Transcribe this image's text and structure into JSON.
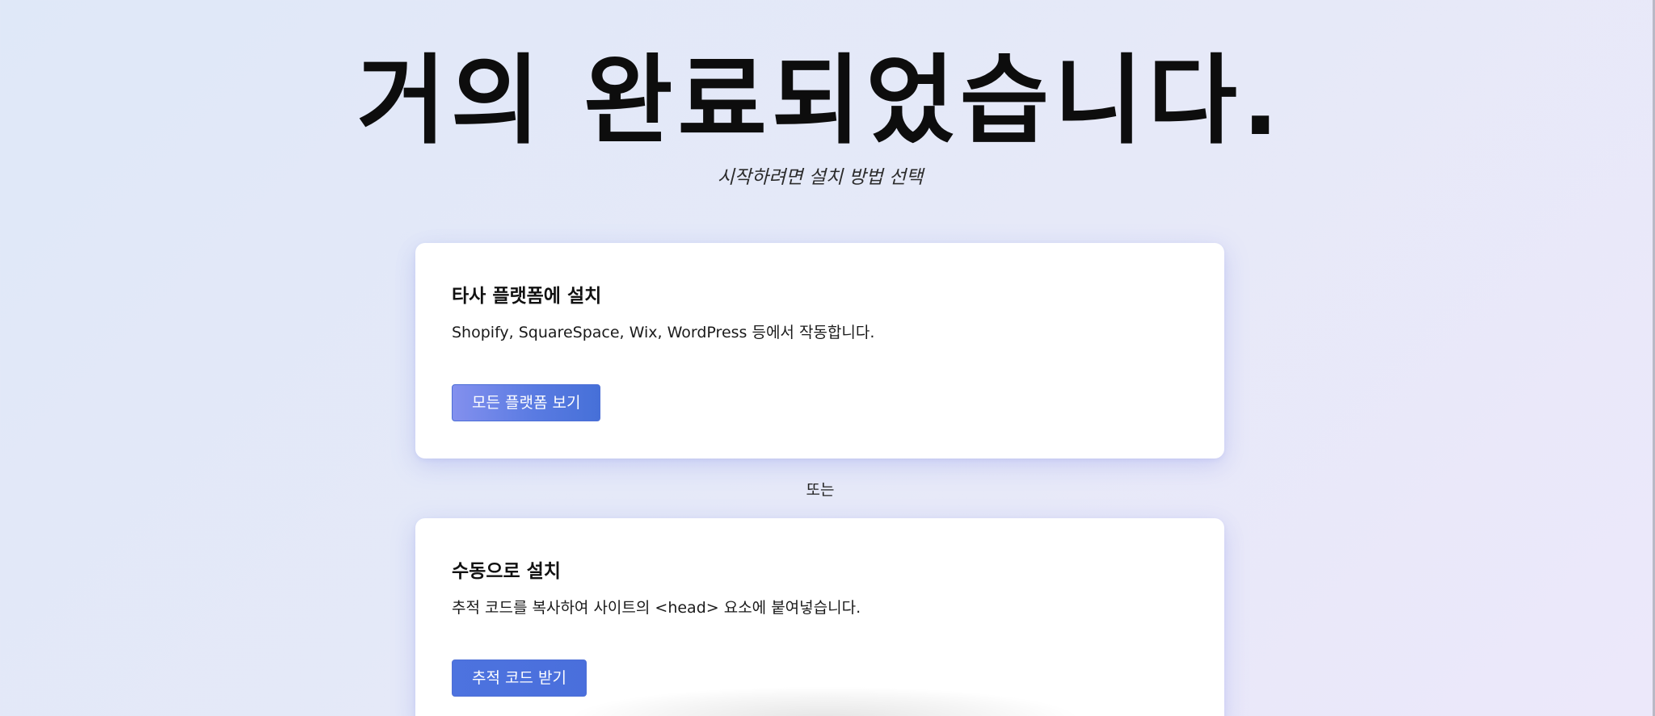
{
  "header": {
    "title": "거의 완료되었습니다.",
    "subtitle": "시작하려면 설치 방법 선택"
  },
  "cards": [
    {
      "title": "타사 플랫폼에 설치",
      "description": "Shopify, SquareSpace, Wix, WordPress 등에서 작동합니다.",
      "button_label": "모든 플랫폼 보기"
    },
    {
      "title": "수동으로 설치",
      "description": "추적 코드를 복사하여 사이트의 <head> 요소에 붙여넣습니다.",
      "button_label": "추적 코드 받기"
    }
  ],
  "divider": {
    "label": "또는"
  },
  "colors": {
    "background_start": "#dfe8f8",
    "background_end": "#ece8fa",
    "card_background": "#ffffff",
    "button_accent": "#4a6fdc",
    "button_accent_light": "#8390ee",
    "text_primary": "#111111"
  }
}
